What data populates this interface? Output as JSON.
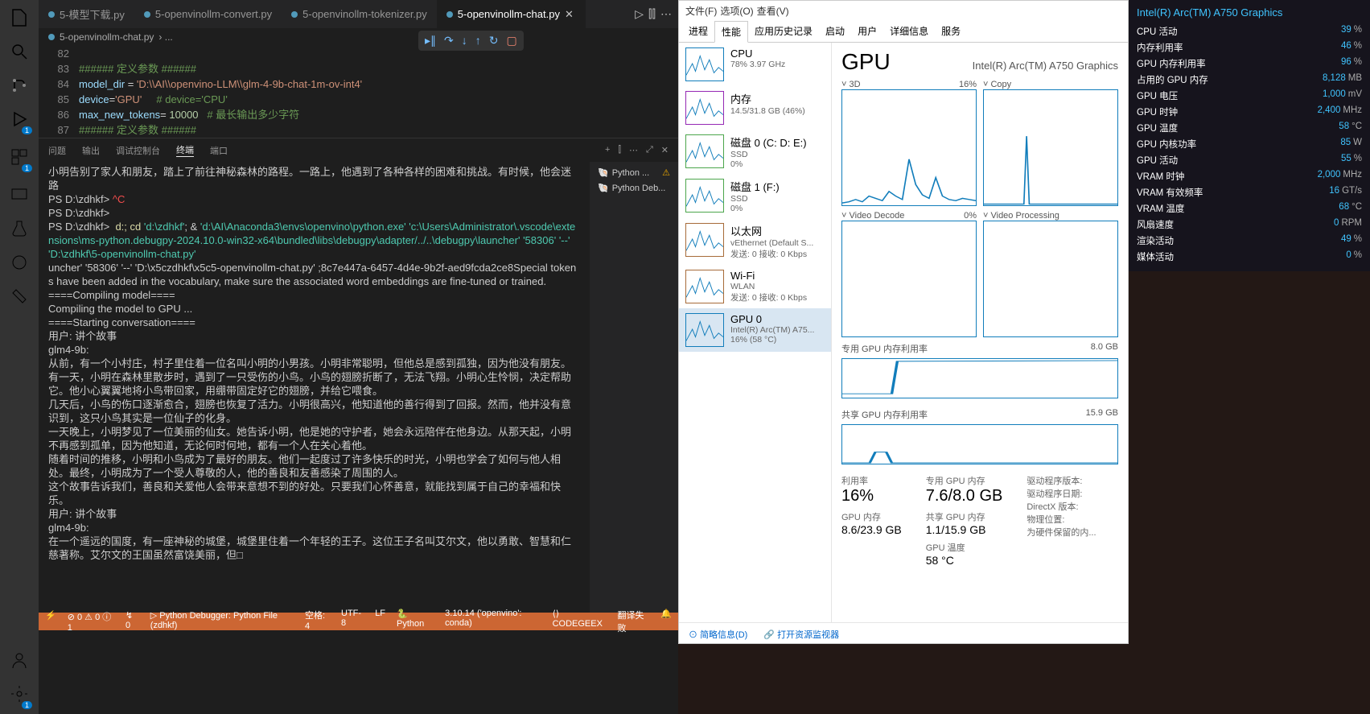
{
  "vscode": {
    "tabs": [
      {
        "label": "5-模型下载.py",
        "active": false
      },
      {
        "label": "5-openvinollm-convert.py",
        "active": false
      },
      {
        "label": "5-openvinollm-tokenizer.py",
        "active": false
      },
      {
        "label": "5-openvinollm-chat.py",
        "active": true
      }
    ],
    "breadcrumb": {
      "file": "5-openvinollm-chat.py",
      "sep": "› ..."
    },
    "lines": [
      82,
      83,
      84,
      85,
      86,
      87
    ],
    "code": {
      "l82": "###### 定义参数 ######",
      "l83": "model_dir",
      "l83b": " = ",
      "l83c": "'D:\\\\AI\\\\openvino-LLM\\\\glm-4-9b-chat-1m-ov-int4'",
      "l84": "device",
      "l84b": "=",
      "l84c": "'GPU'",
      "l84d": "     # device='CPU'",
      "l85": "max_new_tokens",
      "l85b": "= ",
      "l85c": "10000",
      "l85d": "   # 最长输出多少字符",
      "l86": "###### 定义参数 ######"
    },
    "panel": {
      "problems": "问题",
      "output": "输出",
      "debug": "调试控制台",
      "terminal": "终端",
      "ports": "端口"
    },
    "termSide": {
      "python": "Python ...",
      "pydbg": "Python Deb..."
    },
    "terminal": [
      "小明告别了家人和朋友，踏上了前往神秘森林的路程。一路上，他遇到了各种各样的困难和挑战。有时候，他会迷路",
      "PS D:\\zdhkf> ^C",
      "PS D:\\zdhkf>",
      "PS D:\\zdhkf>  d:; cd 'd:\\zdhkf'; & 'd:\\AI\\Anaconda3\\envs\\openvino\\python.exe' 'c:\\Users\\Administrator\\.vscode\\extensions\\ms-python.debugpy-2024.10.0-win32-x64\\bundled\\libs\\debugpy\\adapter/../..\\debugpy\\launcher' '58306' '--' 'D:\\zdhkf\\5-openvinollm-chat.py'",
      "uncher' '58306' '--' 'D:\\x5czdhkf\\x5c5-openvinollm-chat.py' ;8c7e447a-6457-4d4e-9b2f-aed9fcda2ce8Special tokens have been added in the vocabulary, make sure the associated word embeddings are fine-tuned or trained.",
      "====Compiling model====",
      "Compiling the model to GPU ...",
      "====Starting conversation====",
      "用户: 讲个故事",
      "glm4-9b:",
      "从前，有一个小村庄，村子里住着一位名叫小明的小男孩。小明非常聪明，但他总是感到孤独，因为他没有朋友。",
      "",
      "有一天，小明在森林里散步时，遇到了一只受伤的小鸟。小鸟的翅膀折断了，无法飞翔。小明心生怜悯，决定帮助它。他小心翼翼地将小鸟带回家，用绷带固定好它的翅膀，并给它喂食。",
      "",
      "几天后，小鸟的伤口逐渐愈合，翅膀也恢复了活力。小明很高兴，他知道他的善行得到了回报。然而，他并没有意识到，这只小鸟其实是一位仙子的化身。",
      "",
      "一天晚上，小明梦见了一位美丽的仙女。她告诉小明，他是她的守护者，她会永远陪伴在他身边。从那天起，小明不再感到孤单，因为他知道，无论何时何地，都有一个人在关心着他。",
      "",
      "随着时间的推移，小明和小鸟成为了最好的朋友。他们一起度过了许多快乐的时光，小明也学会了如何与他人相处。最终，小明成为了一个受人尊敬的人，他的善良和友善感染了周围的人。",
      "",
      "这个故事告诉我们，善良和关爱他人会带来意想不到的好处。只要我们心怀善意，就能找到属于自己的幸福和快乐。",
      "",
      "用户: 讲个故事",
      "glm4-9b:",
      "在一个遥远的国度，有一座神秘的城堡，城堡里住着一个年轻的王子。这位王子名叫艾尔文，他以勇敢、智慧和仁慈著称。艾尔文的王国虽然富饶美丽，但□"
    ],
    "status": {
      "remote": "⚡",
      "errors": "⊘ 0 ⚠ 0 ⓘ 1",
      "port": "↯ 0",
      "debugger": "▷ Python Debugger: Python File (zdhkf)",
      "spaces": "空格: 4",
      "encoding": "UTF-8",
      "eol": "LF",
      "lang": "🐍 Python",
      "interp": "3.10.14 ('openvino': conda)",
      "codegeex": "⟨⟩ CODEGEEX",
      "trans": "翻译失败",
      "bell": "🔔"
    }
  },
  "taskmgr": {
    "menu": {
      "file": "文件(F)",
      "options": "选项(O)",
      "view": "查看(V)"
    },
    "tabs": {
      "processes": "进程",
      "performance": "性能",
      "history": "应用历史记录",
      "startup": "启动",
      "users": "用户",
      "details": "详细信息",
      "services": "服务"
    },
    "side": [
      {
        "title": "CPU",
        "line1": "78% 3.97 GHz"
      },
      {
        "title": "内存",
        "line1": "14.5/31.8 GB (46%)"
      },
      {
        "title": "磁盘 0 (C: D: E:)",
        "line1": "SSD",
        "line2": "0%"
      },
      {
        "title": "磁盘 1 (F:)",
        "line1": "SSD",
        "line2": "0%"
      },
      {
        "title": "以太网",
        "line1": "vEthernet (Default S...",
        "line2": "发送: 0 接收: 0 Kbps"
      },
      {
        "title": "Wi-Fi",
        "line1": "WLAN",
        "line2": "发送: 0 接收: 0 Kbps"
      },
      {
        "title": "GPU 0",
        "line1": "Intel(R) Arc(TM) A75...",
        "line2": "16% (58 °C)"
      }
    ],
    "main": {
      "title": "GPU",
      "model": "Intel(R) Arc(TM) A750 Graphics",
      "ch3d": {
        "label": "3D",
        "val": "16%"
      },
      "chCopy": {
        "label": "Copy",
        "val": ""
      },
      "chVdec": {
        "label": "Video Decode",
        "val": "0%"
      },
      "chVproc": {
        "label": "Video Processing",
        "val": ""
      },
      "mem1": {
        "label": "专用 GPU 内存利用率",
        "val": "8.0 GB"
      },
      "mem2": {
        "label": "共享 GPU 内存利用率",
        "val": "15.9 GB"
      },
      "util": {
        "label": "利用率",
        "val": "16%"
      },
      "ded": {
        "label": "专用 GPU 内存",
        "val": "7.6/8.0 GB"
      },
      "gmem": {
        "label": "GPU 内存",
        "val": "8.6/23.9 GB"
      },
      "shr": {
        "label": "共享 GPU 内存",
        "val": "1.1/15.9 GB"
      },
      "temp": {
        "label": "GPU 温度",
        "val": "58 °C"
      },
      "drv": {
        "ver": "驱动程序版本:",
        "date": "驱动程序日期:",
        "dx": "DirectX 版本:",
        "loc": "物理位置:",
        "reserved": "为硬件保留的内..."
      }
    },
    "foot": {
      "brief": "简略信息(D)",
      "resmon": "打开资源监视器"
    }
  },
  "overlay": {
    "title": "Intel(R) Arc(TM) A750 Graphics",
    "rows": [
      {
        "k": "CPU 活动",
        "v": "39",
        "u": "%"
      },
      {
        "k": "内存利用率",
        "v": "46",
        "u": "%"
      },
      {
        "k": "GPU 内存利用率",
        "v": "96",
        "u": "%"
      },
      {
        "k": "占用的 GPU 内存",
        "v": "8,128",
        "u": "MB"
      },
      {
        "k": "GPU 电压",
        "v": "1,000",
        "u": "mV"
      },
      {
        "k": "GPU 时钟",
        "v": "2,400",
        "u": "MHz"
      },
      {
        "k": "GPU 温度",
        "v": "58",
        "u": "°C"
      },
      {
        "k": "GPU 内核功率",
        "v": "85",
        "u": "W"
      },
      {
        "k": "GPU 活动",
        "v": "55",
        "u": "%"
      },
      {
        "k": "VRAM 时钟",
        "v": "2,000",
        "u": "MHz"
      },
      {
        "k": "VRAM 有效频率",
        "v": "16",
        "u": "GT/s"
      },
      {
        "k": "VRAM 温度",
        "v": "68",
        "u": "°C"
      },
      {
        "k": "风扇速度",
        "v": "0",
        "u": "RPM"
      },
      {
        "k": "渲染活动",
        "v": "49",
        "u": "%"
      },
      {
        "k": "媒体活动",
        "v": "0",
        "u": "%"
      }
    ]
  },
  "chart_data": {
    "type": "line",
    "title": "GPU 3D utilisation over time",
    "ylim": [
      0,
      100
    ],
    "series": [
      {
        "name": "3D",
        "values": [
          2,
          3,
          5,
          3,
          8,
          6,
          4,
          12,
          8,
          5,
          40,
          18,
          9,
          6,
          24,
          8,
          5,
          4,
          6,
          5,
          4
        ]
      }
    ]
  }
}
